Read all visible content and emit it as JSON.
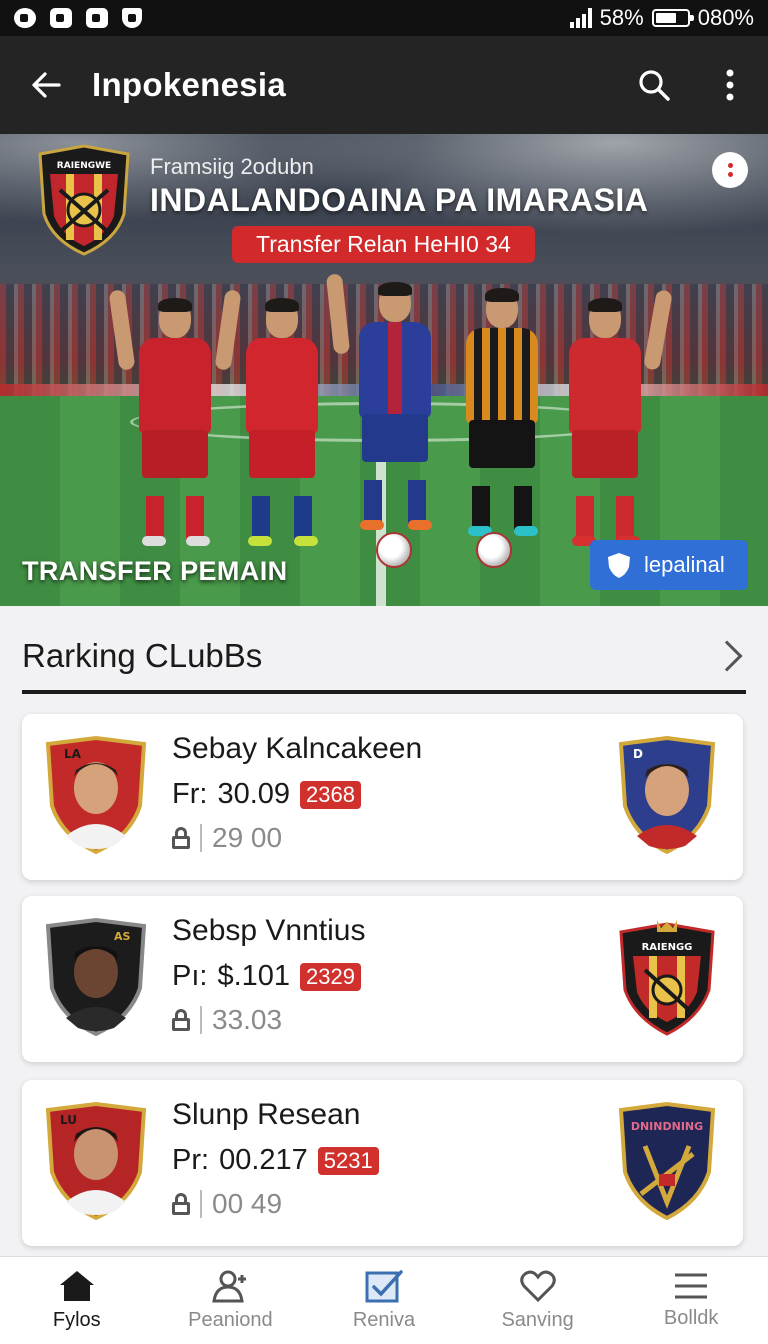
{
  "status_bar": {
    "battery_percent": "58%",
    "clock": "080%"
  },
  "app_bar": {
    "title": "Inpokenesia",
    "back_icon": "arrow-left-icon",
    "search_icon": "search-icon",
    "menu_icon": "more-vertical-icon"
  },
  "hero": {
    "kicker": "Framsiig 2odubn",
    "headline": "INDALANDOAINA PA IMARASIA",
    "pill": "Transfer Relan HeHI0 34",
    "caption": "TRANSFER PEMAIN",
    "cta": "lepalinal",
    "crest_text": "RAIENGWE"
  },
  "section": {
    "title": "Rarking CLubBs"
  },
  "players": [
    {
      "name": "Sebay Kalncakeen",
      "price_label": "Fr:",
      "price": "30.09",
      "badge": "2368",
      "meta": "29 00",
      "avatar_text": "LA",
      "crest_text": "D"
    },
    {
      "name": "Sebsp Vnntius",
      "price_label": "Pı:",
      "price": "$.101",
      "badge": "2329",
      "meta": "33.03",
      "avatar_text": "AS",
      "crest_text": "RAIENGG"
    },
    {
      "name": "Slunp Resean",
      "price_label": "Pr:",
      "price": "00.217",
      "badge": "5231",
      "meta": "00 49",
      "avatar_text": "LU",
      "crest_text": "DNINDNING"
    }
  ],
  "bottom_nav": [
    {
      "label": "Fylos",
      "icon": "home-icon",
      "active": true
    },
    {
      "label": "Peaniond",
      "icon": "person-add-icon",
      "active": false
    },
    {
      "label": "Reniva",
      "icon": "check-square-icon",
      "active": false
    },
    {
      "label": "Sanving",
      "icon": "heart-icon",
      "active": false
    },
    {
      "label": "Bolldk",
      "icon": "menu-icon",
      "active": false
    }
  ],
  "colors": {
    "accent_red": "#d0312d",
    "cta_blue": "#2f6fd6",
    "app_bar": "#242424"
  }
}
